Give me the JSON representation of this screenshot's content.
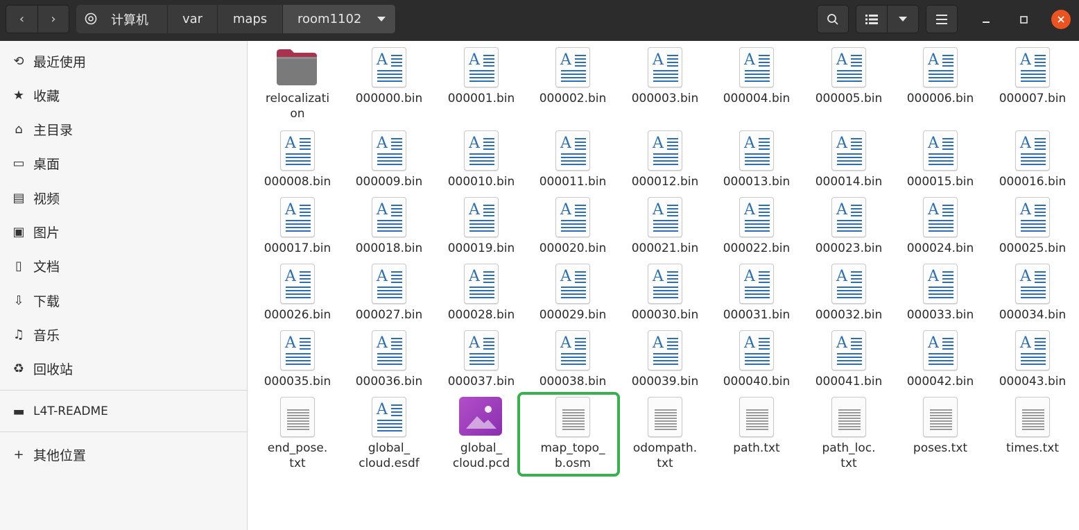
{
  "header": {
    "computer_label": "计算机",
    "path": [
      "var",
      "maps",
      "room1102"
    ],
    "back_label": "‹",
    "forward_label": "›"
  },
  "sidebar": {
    "places": [
      {
        "label": "最近使用",
        "icon": "recent-icon"
      },
      {
        "label": "收藏",
        "icon": "star-icon"
      },
      {
        "label": "主目录",
        "icon": "home-icon"
      },
      {
        "label": "桌面",
        "icon": "desktop-icon"
      },
      {
        "label": "视频",
        "icon": "video-icon"
      },
      {
        "label": "图片",
        "icon": "picture-icon"
      },
      {
        "label": "文档",
        "icon": "document-icon"
      },
      {
        "label": "下载",
        "icon": "download-icon"
      },
      {
        "label": "音乐",
        "icon": "music-icon"
      },
      {
        "label": "回收站",
        "icon": "trash-icon"
      }
    ],
    "device": {
      "label": "L4T-README",
      "icon": "drive-icon"
    },
    "other": {
      "label": "其他位置",
      "icon": "plus-icon"
    }
  },
  "files": [
    {
      "name": "relocalization",
      "type": "folder"
    },
    {
      "name": "000000.bin",
      "type": "doc"
    },
    {
      "name": "000001.bin",
      "type": "doc"
    },
    {
      "name": "000002.bin",
      "type": "doc"
    },
    {
      "name": "000003.bin",
      "type": "doc"
    },
    {
      "name": "000004.bin",
      "type": "doc"
    },
    {
      "name": "000005.bin",
      "type": "doc"
    },
    {
      "name": "000006.bin",
      "type": "doc"
    },
    {
      "name": "000007.bin",
      "type": "doc"
    },
    {
      "name": "000008.bin",
      "type": "doc"
    },
    {
      "name": "000009.bin",
      "type": "doc"
    },
    {
      "name": "000010.bin",
      "type": "doc"
    },
    {
      "name": "000011.bin",
      "type": "doc"
    },
    {
      "name": "000012.bin",
      "type": "doc"
    },
    {
      "name": "000013.bin",
      "type": "doc"
    },
    {
      "name": "000014.bin",
      "type": "doc"
    },
    {
      "name": "000015.bin",
      "type": "doc"
    },
    {
      "name": "000016.bin",
      "type": "doc"
    },
    {
      "name": "000017.bin",
      "type": "doc"
    },
    {
      "name": "000018.bin",
      "type": "doc"
    },
    {
      "name": "000019.bin",
      "type": "doc"
    },
    {
      "name": "000020.bin",
      "type": "doc"
    },
    {
      "name": "000021.bin",
      "type": "doc"
    },
    {
      "name": "000022.bin",
      "type": "doc"
    },
    {
      "name": "000023.bin",
      "type": "doc"
    },
    {
      "name": "000024.bin",
      "type": "doc"
    },
    {
      "name": "000025.bin",
      "type": "doc"
    },
    {
      "name": "000026.bin",
      "type": "doc"
    },
    {
      "name": "000027.bin",
      "type": "doc"
    },
    {
      "name": "000028.bin",
      "type": "doc"
    },
    {
      "name": "000029.bin",
      "type": "doc"
    },
    {
      "name": "000030.bin",
      "type": "doc"
    },
    {
      "name": "000031.bin",
      "type": "doc"
    },
    {
      "name": "000032.bin",
      "type": "doc"
    },
    {
      "name": "000033.bin",
      "type": "doc"
    },
    {
      "name": "000034.bin",
      "type": "doc"
    },
    {
      "name": "000035.bin",
      "type": "doc"
    },
    {
      "name": "000036.bin",
      "type": "doc"
    },
    {
      "name": "000037.bin",
      "type": "doc"
    },
    {
      "name": "000038.bin",
      "type": "doc"
    },
    {
      "name": "000039.bin",
      "type": "doc"
    },
    {
      "name": "000040.bin",
      "type": "doc"
    },
    {
      "name": "000041.bin",
      "type": "doc"
    },
    {
      "name": "000042.bin",
      "type": "doc"
    },
    {
      "name": "000043.bin",
      "type": "doc"
    },
    {
      "name": "end_pose.txt",
      "type": "txt"
    },
    {
      "name": "global_cloud.esdf",
      "type": "doc"
    },
    {
      "name": "global_cloud.pcd",
      "type": "image"
    },
    {
      "name": "map_topo_b.osm",
      "type": "txt"
    },
    {
      "name": "odompath.txt",
      "type": "txt"
    },
    {
      "name": "path.txt",
      "type": "txt"
    },
    {
      "name": "path_loc.txt",
      "type": "txt"
    },
    {
      "name": "poses.txt",
      "type": "txt"
    },
    {
      "name": "times.txt",
      "type": "txt"
    }
  ],
  "file_display_names": [
    "relocalizati\non",
    "000000.bin",
    "000001.bin",
    "000002.bin",
    "000003.bin",
    "000004.bin",
    "000005.bin",
    "000006.bin",
    "000007.bin",
    "000008.bin",
    "000009.bin",
    "000010.bin",
    "000011.bin",
    "000012.bin",
    "000013.bin",
    "000014.bin",
    "000015.bin",
    "000016.bin",
    "000017.bin",
    "000018.bin",
    "000019.bin",
    "000020.bin",
    "000021.bin",
    "000022.bin",
    "000023.bin",
    "000024.bin",
    "000025.bin",
    "000026.bin",
    "000027.bin",
    "000028.bin",
    "000029.bin",
    "000030.bin",
    "000031.bin",
    "000032.bin",
    "000033.bin",
    "000034.bin",
    "000035.bin",
    "000036.bin",
    "000037.bin",
    "000038.bin",
    "000039.bin",
    "000040.bin",
    "000041.bin",
    "000042.bin",
    "000043.bin",
    "end_pose.\ntxt",
    "global_\ncloud.esdf",
    "global_\ncloud.pcd",
    "map_topo_\nb.osm",
    "odompath.\ntxt",
    "path.txt",
    "path_loc.\ntxt",
    "poses.txt",
    "times.txt"
  ],
  "highlighted_file": "map_topo_b.osm",
  "colors": {
    "highlight": "#37b24d",
    "close_button": "#e95420",
    "doc_accent": "#2a6fb4"
  }
}
